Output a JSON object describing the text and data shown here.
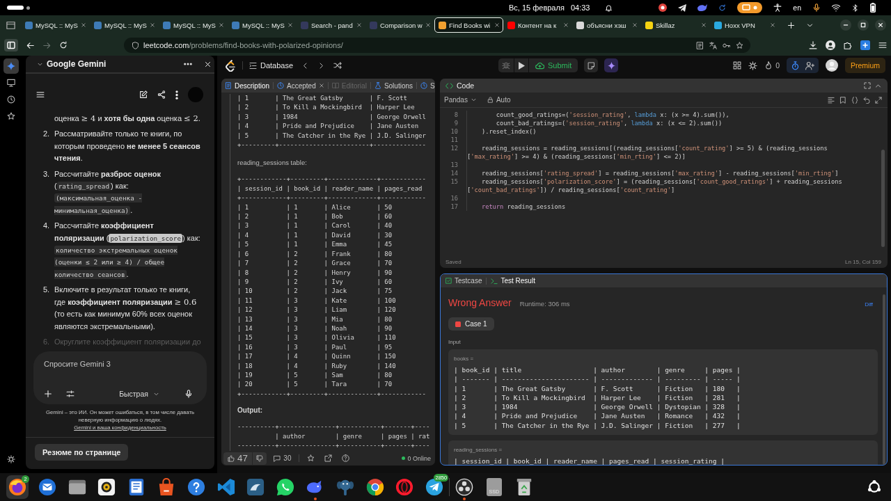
{
  "system_bar": {
    "date": "Вс, 15 февраля",
    "time": "04:33",
    "language": "en"
  },
  "browser": {
    "tabs": [
      {
        "label": "MySQL :: MyS",
        "selected": false,
        "color": "#3e7bb6"
      },
      {
        "label": "MySQL :: MyS",
        "selected": false,
        "color": "#3e7bb6"
      },
      {
        "label": "MySQL :: MyS",
        "selected": false,
        "color": "#3e7bb6"
      },
      {
        "label": "MySQL :: MyS",
        "selected": false,
        "color": "#3e7bb6"
      },
      {
        "label": "Search - pand",
        "selected": false,
        "color": "#34395c"
      },
      {
        "label": "Comparison w",
        "selected": false,
        "color": "#34395c"
      },
      {
        "label": "Find Books wi",
        "selected": true,
        "color": "#f0a030"
      },
      {
        "label": "Контент на к",
        "selected": false,
        "color": "#ff0000"
      },
      {
        "label": "объясни хэш",
        "selected": false,
        "color": "#d9d9d9"
      },
      {
        "label": "Skillaz",
        "selected": false,
        "color": "#f5d312"
      },
      {
        "label": "Hoxx VPN",
        "selected": false,
        "color": "#2aa9e0"
      }
    ],
    "url": {
      "host": "leetcode.com",
      "path": "/problems/find-books-with-polarized-opinions/"
    }
  },
  "sidebar": {
    "items": [
      {
        "selected": true
      },
      {
        "selected": false
      },
      {
        "selected": false
      },
      {
        "selected": false
      }
    ]
  },
  "gemini": {
    "title": "Google Gemini",
    "continuation": [
      {
        "kind": "text",
        "text": "оценка "
      },
      {
        "kind": "math",
        "text": "≥ 4"
      },
      {
        "kind": "text",
        "text": " и **хотя бы одна** оценка "
      },
      {
        "kind": "math",
        "text": "≤ 2"
      },
      {
        "kind": "text",
        "text": "."
      }
    ],
    "steps": [
      {
        "number": "2.",
        "faded": false,
        "parts": [
          {
            "kind": "text",
            "text": "Рассматривайте только те книги, по которым проведено **не менее 5 сеансов чтения**."
          }
        ]
      },
      {
        "number": "3.",
        "faded": false,
        "parts": [
          {
            "kind": "text",
            "text": "Рассчитайте **разброс оценок** ("
          },
          {
            "kind": "code",
            "text": "rating_spread"
          },
          {
            "kind": "text",
            "text": ") как: "
          },
          {
            "kind": "code",
            "text": "(максимальная_оценка - минимальная_оценка)"
          },
          {
            "kind": "text",
            "text": "."
          }
        ]
      },
      {
        "number": "4.",
        "faded": false,
        "parts": [
          {
            "kind": "text",
            "text": "Рассчитайте **коэффициент поляризации** ("
          },
          {
            "kind": "highlight",
            "text": "polarization_score"
          },
          {
            "kind": "text",
            "text": ") как: "
          },
          {
            "kind": "code",
            "text": "количество экстремальных оценок (оценки ≤ 2 или ≥ 4) / общее количество сеансов"
          },
          {
            "kind": "text",
            "text": "."
          }
        ]
      },
      {
        "number": "5.",
        "faded": false,
        "parts": [
          {
            "kind": "text",
            "text": "Включите в результат только те книги, где **коэффициент поляризации** "
          },
          {
            "kind": "math",
            "text": "≥ 0.6"
          },
          {
            "kind": "text",
            "text": " (то есть как минимум 60% всех оценок являются экстремальными)."
          }
        ]
      },
      {
        "number": "6.",
        "faded": true,
        "parts": [
          {
            "kind": "text",
            "text": "Округлите коэффициент поляризации до"
          }
        ]
      }
    ],
    "input": {
      "placeholder": "Спросите Gemini 3",
      "mode": "Быстрая"
    },
    "disclaimer": "Gemini – это ИИ. Он может ошибаться, в том числе давать неверную информацию о людях.",
    "privacy_link": "Gemini и ваша конфиденциальность",
    "summary_button": "Резюме по странице"
  },
  "leetcode": {
    "section": "Database",
    "submit": "Submit",
    "streak": "0",
    "premium": "Premium"
  },
  "description": {
    "tabs": [
      {
        "label": "Description",
        "selected": true,
        "disabled": false,
        "closable": false
      },
      {
        "label": "Accepted",
        "selected": false,
        "disabled": false,
        "closable": true
      },
      {
        "label": "Editorial",
        "selected": false,
        "disabled": true,
        "closable": false
      },
      {
        "label": "Solutions",
        "selected": false,
        "disabled": false,
        "closable": false
      },
      {
        "label": "S",
        "selected": false,
        "disabled": false,
        "closable": false
      }
    ],
    "blocks": [
      {
        "kind": "pre",
        "lines": [
          "| 1       | The Great Gatsby       | F. Scott",
          "| 2       | To Kill a Mockingbird  | Harper Lee",
          "| 3       | 1984                   | George Orwell",
          "| 4       | Pride and Prejudice    | Jane Austen",
          "| 5       | The Catcher in the Rye | J.D. Salinger",
          "+---------+------------------------+--------------"
        ]
      },
      {
        "kind": "caption",
        "text": "reading_sessions table:"
      },
      {
        "kind": "pre",
        "lines": [
          "+------------+---------+-------------+------------",
          "| session_id | book_id | reader_name | pages_read",
          "+------------+---------+-------------+------------",
          "| 1          | 1       | Alice       | 50",
          "| 2          | 1       | Bob         | 60",
          "| 3          | 1       | Carol       | 40",
          "| 4          | 1       | David       | 30",
          "| 5          | 1       | Emma        | 45",
          "| 6          | 2       | Frank       | 80",
          "| 7          | 2       | Grace       | 70",
          "| 8          | 2       | Henry       | 90",
          "| 9          | 2       | Ivy         | 60",
          "| 10         | 2       | Jack        | 75",
          "| 11         | 3       | Kate        | 100",
          "| 12         | 3       | Liam        | 120",
          "| 13         | 3       | Mia         | 80",
          "| 14         | 3       | Noah        | 90",
          "| 15         | 3       | Olivia      | 110",
          "| 16         | 3       | Paul        | 95",
          "| 17         | 4       | Quinn       | 150",
          "| 18         | 4       | Ruby        | 140",
          "| 19         | 5       | Sam         | 80",
          "| 20         | 5       | Tara        | 70",
          "+------------+---------+-------------+------------"
        ]
      },
      {
        "kind": "heading",
        "text": "Output:"
      },
      {
        "kind": "pre",
        "lines": [
          "----------+---------------+-----------+-------+----",
          "          | author        | genre     | pages | rat",
          "----------+---------------+-----------+-------+----"
        ]
      }
    ],
    "footer": {
      "likes": "47",
      "comments": "30",
      "online": "0 Online"
    }
  },
  "code_panel": {
    "title": "Code",
    "language": "Pandas",
    "mode": "Auto",
    "lines": [
      {
        "number": "8",
        "segments": [
          {
            "kind": "plain",
            "text": "        count_good_ratings=("
          },
          {
            "kind": "string",
            "text": "'session_rating'"
          },
          {
            "kind": "plain",
            "text": ", "
          },
          {
            "kind": "keyword",
            "text": "lambda"
          },
          {
            "kind": "plain",
            "text": " x: (x >= 4).sum()),"
          }
        ]
      },
      {
        "number": "9",
        "segments": [
          {
            "kind": "plain",
            "text": "        count_bad_ratings=("
          },
          {
            "kind": "string",
            "text": "'session_rating'"
          },
          {
            "kind": "plain",
            "text": ", "
          },
          {
            "kind": "keyword",
            "text": "lambda"
          },
          {
            "kind": "plain",
            "text": " x: (x <= 2).sum())"
          }
        ]
      },
      {
        "number": "10",
        "segments": [
          {
            "kind": "plain",
            "text": "    ).reset_index()"
          }
        ]
      },
      {
        "number": "11"
      },
      {
        "number": "12",
        "segments": [
          {
            "kind": "plain",
            "text": "    reading_sessions = reading_sessions[(reading_sessions["
          },
          {
            "kind": "string",
            "text": "'count_rating'"
          },
          {
            "kind": "plain",
            "text": "] >= 5) & (reading_sessions"
          }
        ],
        "wrapped": [
          {
            "kind": "plain",
            "text": "["
          },
          {
            "kind": "string",
            "text": "'max_rating'"
          },
          {
            "kind": "plain",
            "text": "] >= 4) & (reading_sessions["
          },
          {
            "kind": "string",
            "text": "'min_rting'"
          },
          {
            "kind": "plain",
            "text": "] <= 2)]"
          }
        ]
      },
      {
        "number": "13"
      },
      {
        "number": "14",
        "segments": [
          {
            "kind": "plain",
            "text": "    reading_sessions["
          },
          {
            "kind": "string",
            "text": "'rating_spread'"
          },
          {
            "kind": "plain",
            "text": "] = reading_sessions["
          },
          {
            "kind": "string",
            "text": "'max_rating'"
          },
          {
            "kind": "plain",
            "text": "] - reading_sessions["
          },
          {
            "kind": "string",
            "text": "'min_rting'"
          },
          {
            "kind": "plain",
            "text": "]"
          }
        ]
      },
      {
        "number": "15",
        "segments": [
          {
            "kind": "plain",
            "text": "    reading_sessions["
          },
          {
            "kind": "string",
            "text": "'polarization_score'"
          },
          {
            "kind": "plain",
            "text": "] = (reading_sessions["
          },
          {
            "kind": "string",
            "text": "'count_good_ratings'"
          },
          {
            "kind": "plain",
            "text": "] + reading_sessions"
          }
        ],
        "wrapped": [
          {
            "kind": "plain",
            "text": "["
          },
          {
            "kind": "string",
            "text": "'count_bad_ratings'"
          },
          {
            "kind": "plain",
            "text": "]) / reading_sessions["
          },
          {
            "kind": "string",
            "text": "'count_rating'"
          },
          {
            "kind": "plain",
            "text": "]"
          }
        ]
      },
      {
        "number": "16"
      },
      {
        "number": "17",
        "segments": [
          {
            "kind": "control",
            "text": "    return"
          },
          {
            "kind": "plain",
            "text": " reading_sessions"
          }
        ]
      }
    ],
    "status": "Saved",
    "cursor": "Ln 15, Col 159"
  },
  "test_panel": {
    "tabs": [
      {
        "label": "Testcase",
        "selected": false
      },
      {
        "label": "Test Result",
        "selected": true
      }
    ],
    "verdict": "Wrong Answer",
    "accepted": false,
    "runtime": "Runtime: 306 ms",
    "diff": "Diff",
    "cases": [
      {
        "label": "Case 1",
        "passed": false
      }
    ],
    "input_label": "Input",
    "inputs": [
      {
        "name": "books =",
        "lines": [
          "| book_id | title                  | author        | genre     | pages |",
          "| ------- | ---------------------- | ------------- | --------- | ----- |",
          "| 1       | The Great Gatsby       | F. Scott      | Fiction   | 180   |",
          "| 2       | To Kill a Mockingbird  | Harper Lee    | Fiction   | 281   |",
          "| 3       | 1984                   | George Orwell | Dystopian | 328   |",
          "| 4       | Pride and Prejudice    | Jane Austen   | Romance   | 432   |",
          "| 5       | The Catcher in the Rye | J.D. Salinger | Fiction   | 277   |"
        ]
      },
      {
        "name": "reading_sessions =",
        "lines": [
          "| session_id | book_id | reader_name | pages_read | session_rating |"
        ]
      }
    ]
  },
  "dock": {
    "apps": [
      {
        "active": true,
        "running": false,
        "badge": "2"
      },
      {
        "active": false,
        "running": false
      },
      {
        "active": false,
        "running": false
      },
      {
        "active": false,
        "running": false
      },
      {
        "active": false,
        "running": false
      },
      {
        "active": false,
        "running": false
      },
      {
        "active": false,
        "running": false
      },
      {
        "active": false,
        "running": false
      },
      {
        "active": false,
        "running": false
      },
      {
        "active": false,
        "running": false
      },
      {
        "active": false,
        "running": true
      },
      {
        "active": false,
        "running": false
      },
      {
        "active": false,
        "running": false
      },
      {
        "active": false,
        "running": false
      },
      {
        "active": false,
        "running": false,
        "badge": "2850"
      },
      {
        "active": false,
        "running": true
      },
      {
        "active": false,
        "running": false,
        "label": "SSD"
      },
      {
        "active": false,
        "running": false
      }
    ]
  }
}
